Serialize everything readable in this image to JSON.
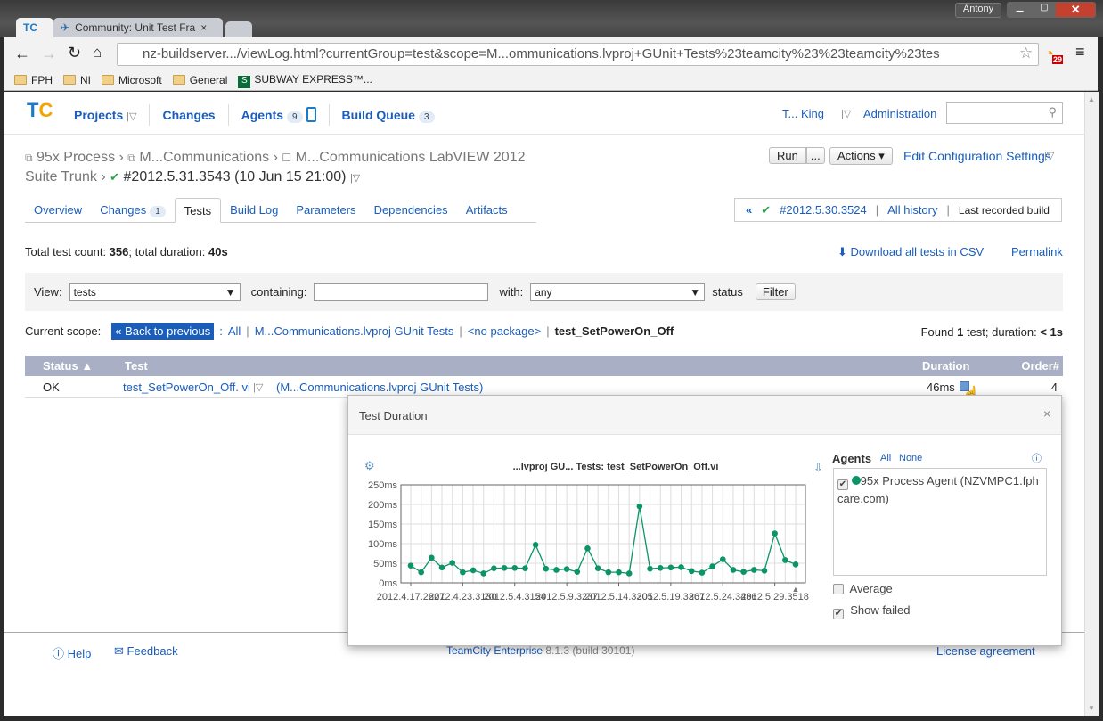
{
  "browser": {
    "tabs": [
      {
        "label": "TC"
      },
      {
        "label": "Community: Unit Test Fra"
      }
    ],
    "user": "Antony",
    "url": "nz-buildserver.../viewLog.html?currentGroup=test&scope=M...ommunications.lvproj+GUnit+Tests%23teamcity%23%23teamcity%23tes",
    "rss_count": "29",
    "bookmarks": [
      {
        "label": "FPH"
      },
      {
        "label": "NI"
      },
      {
        "label": "Microsoft"
      },
      {
        "label": "General"
      },
      {
        "label": "SUBWAY EXPRESS™..."
      }
    ]
  },
  "nav": {
    "items": [
      {
        "label": "Projects"
      },
      {
        "label": "Changes"
      },
      {
        "label": "Agents",
        "count": "9"
      },
      {
        "label": "Build Queue",
        "count": "3"
      }
    ],
    "user": "T... King",
    "admin": "Administration",
    "search_placeholder": ""
  },
  "breadcrumb": {
    "project": "95x Process",
    "subproject": "M...Communications",
    "config": "M...Communications LabVIEW 2012",
    "config2": "Suite Trunk",
    "build": "#2012.5.31.3543 (10 Jun 15 21:00)"
  },
  "actions": {
    "run": "Run",
    "more": "...",
    "actions": "Actions",
    "edit": "Edit Configuration Settings"
  },
  "tabs": [
    {
      "label": "Overview"
    },
    {
      "label": "Changes",
      "count": "1"
    },
    {
      "label": "Tests"
    },
    {
      "label": "Build Log"
    },
    {
      "label": "Parameters"
    },
    {
      "label": "Dependencies"
    },
    {
      "label": "Artifacts"
    }
  ],
  "history": {
    "prev": "#2012.5.30.3524",
    "all": "All history",
    "last": "Last recorded build"
  },
  "summary": {
    "prefix": "Total test count: ",
    "count": "356",
    "mid": "; total duration: ",
    "duration": "40s"
  },
  "links": {
    "csv": "Download all tests in CSV",
    "permalink": "Permalink"
  },
  "filter": {
    "view_label": "View:",
    "view_value": "tests",
    "containing_label": "containing:",
    "containing_value": "",
    "with_label": "with:",
    "with_value": "any",
    "status_label": "status",
    "filter_button": "Filter"
  },
  "scope": {
    "label": "Current scope:",
    "back": "« Back to previous",
    "all": "All",
    "suite": "M...Communications.lvproj GUnit Tests",
    "package": "<no package>",
    "current": "test_SetPowerOn_Off",
    "found_prefix": "Found ",
    "found_count": "1",
    "found_mid": " test; duration: ",
    "found_duration": "< 1s"
  },
  "table": {
    "headers": [
      "Status ▲",
      "Test",
      "Duration",
      "Order#"
    ],
    "rows": [
      {
        "status": "OK",
        "test": "test_SetPowerOn_Off. vi",
        "suite": "(M...Communications.lvproj GUnit Tests)",
        "duration": "46ms",
        "order": "4"
      }
    ]
  },
  "popup": {
    "title": "Test Duration",
    "close": "×",
    "agents_label": "Agents",
    "all": "All",
    "none": "None",
    "agent": "95x Process Agent (NZVMPC1.fphcare.com)",
    "average": "Average",
    "show_failed": "Show failed",
    "average_checked": false,
    "show_failed_checked": true
  },
  "chart_data": {
    "type": "line",
    "title": "...lvproj GU... Tests: test_SetPowerOn_Off.vi",
    "ylim": [
      0,
      250
    ],
    "yticks": [
      "0ms",
      "50ms",
      "100ms",
      "150ms",
      "200ms",
      "250ms"
    ],
    "grid": true,
    "color": "#0a9467",
    "xticklabels": [
      "2012.4.17.2827",
      "2012.4.23.3130",
      "2012.5.4.3154",
      "2012.5.9.3237",
      "2012.5.14.3305",
      "2012.5.19.3367",
      "2012.5.24.3436",
      "2012.5.29.3518"
    ],
    "values": [
      44,
      27,
      64,
      39,
      51,
      27,
      32,
      24,
      37,
      38,
      38,
      37,
      97,
      36,
      33,
      35,
      28,
      88,
      37,
      27,
      27,
      24,
      195,
      36,
      38,
      39,
      40,
      30,
      26,
      42,
      60,
      33,
      28,
      33,
      31,
      126,
      58,
      47
    ]
  },
  "footer": {
    "help": "Help",
    "feedback": "Feedback",
    "product": "TeamCity Enterprise",
    "version": "8.1.3 (build 30101)",
    "license": "License agreement"
  }
}
